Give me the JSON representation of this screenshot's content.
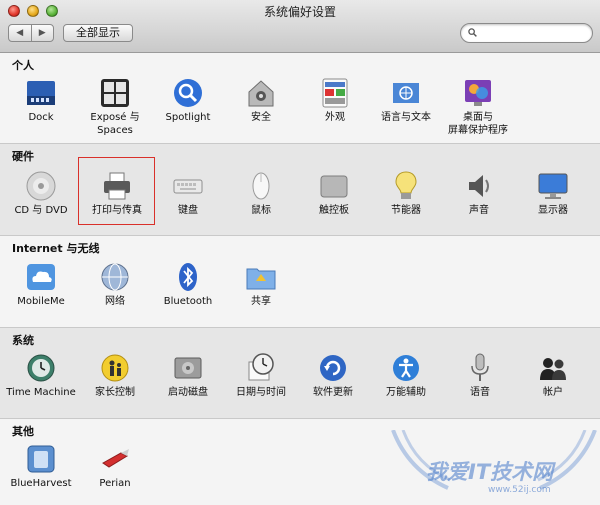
{
  "window": {
    "title": "系统偏好设置"
  },
  "toolbar": {
    "back_arrow": "◀",
    "forward_arrow": "▶",
    "show_all_label": "全部显示",
    "search_value": ""
  },
  "sections": {
    "personal": {
      "title": "个人",
      "items": [
        "Dock",
        "Exposé 与",
        "Spaces",
        "Spotlight",
        "安全",
        "外观",
        "语言与文本",
        "桌面与",
        "屏幕保护程序"
      ]
    },
    "hardware": {
      "title": "硬件",
      "items": [
        "CD 与 DVD",
        "打印与传真",
        "键盘",
        "鼠标",
        "触控板",
        "节能器",
        "声音",
        "显示器"
      ]
    },
    "internet": {
      "title": "Internet 与无线",
      "items": [
        "MobileMe",
        "网络",
        "Bluetooth",
        "共享"
      ]
    },
    "system": {
      "title": "系统",
      "items": [
        "Time Machine",
        "家长控制",
        "启动磁盘",
        "日期与时间",
        "软件更新",
        "万能辅助",
        "语音",
        "帐户"
      ]
    },
    "other": {
      "title": "其他",
      "items": [
        "BlueHarvest",
        "Perian"
      ]
    }
  },
  "watermark": {
    "text": "我爱IT技术网",
    "url": "www.52ij.com"
  },
  "colors": {
    "highlight_border": "#d9302a",
    "watermark": "#4678c8"
  }
}
